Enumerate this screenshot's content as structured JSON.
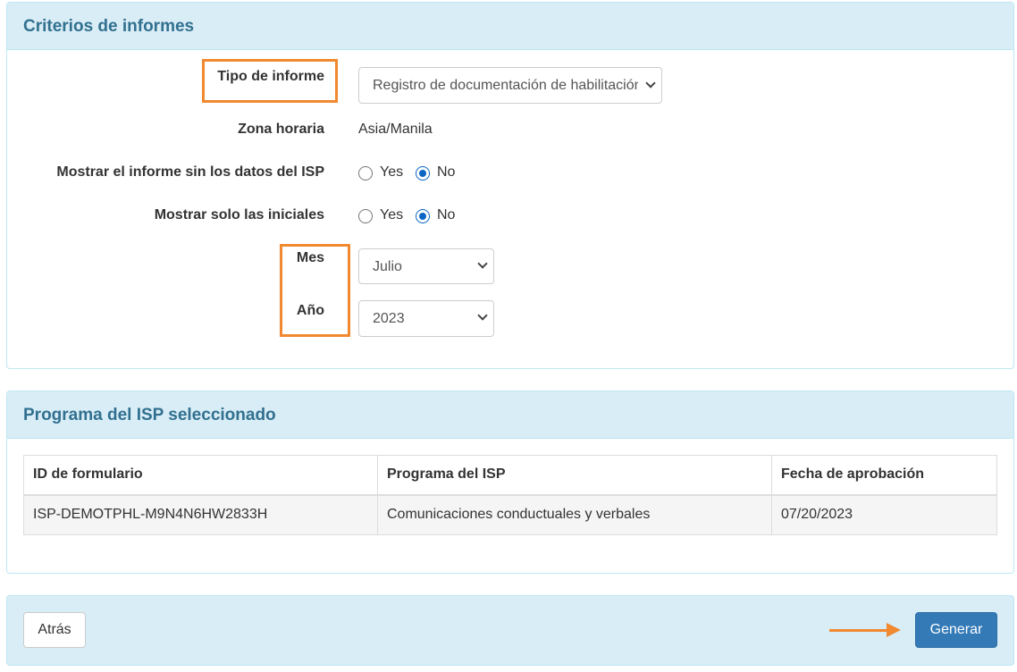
{
  "criteria": {
    "heading": "Criterios de informes",
    "report_type": {
      "label": "Tipo de informe",
      "selected": "Registro de documentación de habilitación"
    },
    "timezone": {
      "label": "Zona horaria",
      "value": "Asia/Manila"
    },
    "hide_isp_data": {
      "label": "Mostrar el informe sin los datos del ISP",
      "yes_label": "Yes",
      "no_label": "No",
      "selected": "No"
    },
    "initials_only": {
      "label": "Mostrar solo las iniciales",
      "yes_label": "Yes",
      "no_label": "No",
      "selected": "No"
    },
    "month": {
      "label": "Mes",
      "selected": "Julio"
    },
    "year": {
      "label": "Año",
      "selected": "2023"
    }
  },
  "program": {
    "heading": "Programa del ISP seleccionado",
    "columns": [
      "ID de formulario",
      "Programa del ISP",
      "Fecha de aprobación"
    ],
    "rows": [
      [
        "ISP-DEMOTPHL-M9N4N6HW2833H",
        "Comunicaciones conductuales y verbales",
        "07/20/2023"
      ]
    ]
  },
  "footer": {
    "back_label": "Atrás",
    "generate_label": "Generar"
  },
  "colors": {
    "panel_heading_bg": "#d9edf7",
    "panel_heading_text": "#31708f",
    "annotation_orange": "#f0892f",
    "primary_button": "#337ab7",
    "radio_checked": "#0a66c2"
  }
}
